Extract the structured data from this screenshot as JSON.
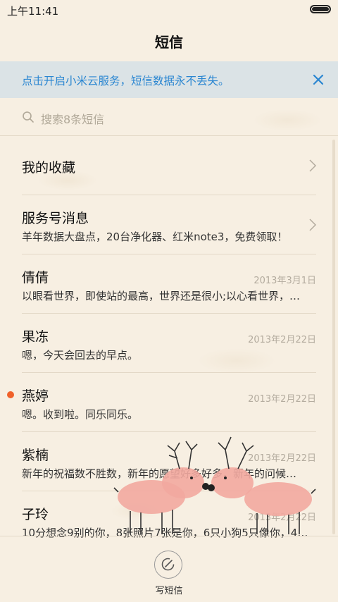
{
  "status_bar": {
    "time": "上午11:41"
  },
  "header": {
    "title": "短信"
  },
  "banner": {
    "text": "点击开启小米云服务，短信数据永不丢失。",
    "accent": "#2a86d1"
  },
  "search": {
    "placeholder": "搜索8条短信"
  },
  "rows": [
    {
      "name": "我的收藏",
      "preview": "",
      "date": "",
      "chevron": true,
      "unread": false
    },
    {
      "name": "服务号消息",
      "preview": "羊年数据大盘点，20台净化器、红米note3，免费领取！",
      "date": "",
      "chevron": true,
      "unread": false
    },
    {
      "name": "倩倩",
      "preview": "以眼看世界，即使站的最高，世界还是很小;以心看世界，…",
      "date": "2013年3月1日",
      "chevron": false,
      "unread": false
    },
    {
      "name": "果冻",
      "preview": "嗯，今天会回去的早点。",
      "date": "2013年2月22日",
      "chevron": false,
      "unread": false
    },
    {
      "name": "燕婷",
      "preview": "嗯。收到啦。同乐同乐。",
      "date": "2013年2月22日",
      "chevron": false,
      "unread": true
    },
    {
      "name": "紫楠",
      "preview": "新年的祝福数不胜数，新年的愿望好多好多，新年的问候…",
      "date": "2013年2月22日",
      "chevron": false,
      "unread": false
    },
    {
      "name": "子玲",
      "preview": "10分想念9别的你，8张照片7张是你，6只小狗5只像你，4…",
      "date": "2013年2月22日",
      "chevron": false,
      "unread": false
    }
  ],
  "compose": {
    "label": "写短信"
  },
  "colors": {
    "unread_dot": "#f0612a",
    "background": "#f7efe2"
  }
}
